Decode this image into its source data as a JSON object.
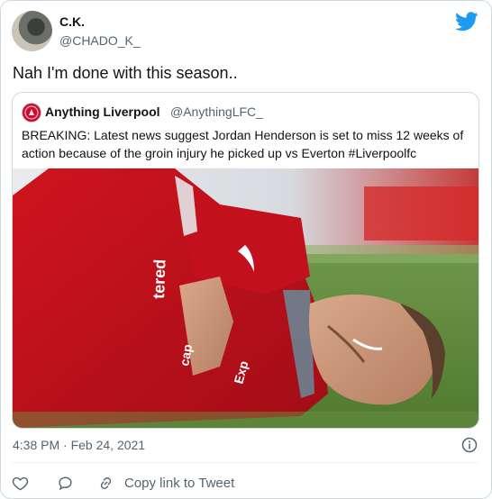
{
  "author": {
    "name": "C.K.",
    "handle": "@CHADO_K_"
  },
  "tweet": {
    "text": "Nah I'm done with this season.."
  },
  "quoted": {
    "name": "Anything Liverpool",
    "handle": "@AnythingLFC_",
    "text": "BREAKING: Latest news suggest Jordan Henderson is set to miss 12 weeks of action because of the groin injury he picked up vs Everton #Liverpoolfc",
    "image": {
      "jersey_sponsor_text": "Standard Chartered",
      "jersey_badge_text": "Expedia"
    }
  },
  "meta": {
    "timestamp": "4:38 PM · Feb 24, 2021"
  },
  "actions": {
    "like_icon": "heart-icon",
    "reply_icon": "reply-icon",
    "copy_link_label": "Copy link to Tweet",
    "copy_link_icon": "link-icon"
  },
  "colors": {
    "twitter_blue": "#1d9bf0",
    "liverpool_red": "#c8102e",
    "secondary_text": "#536471",
    "border": "#cfd9de"
  }
}
